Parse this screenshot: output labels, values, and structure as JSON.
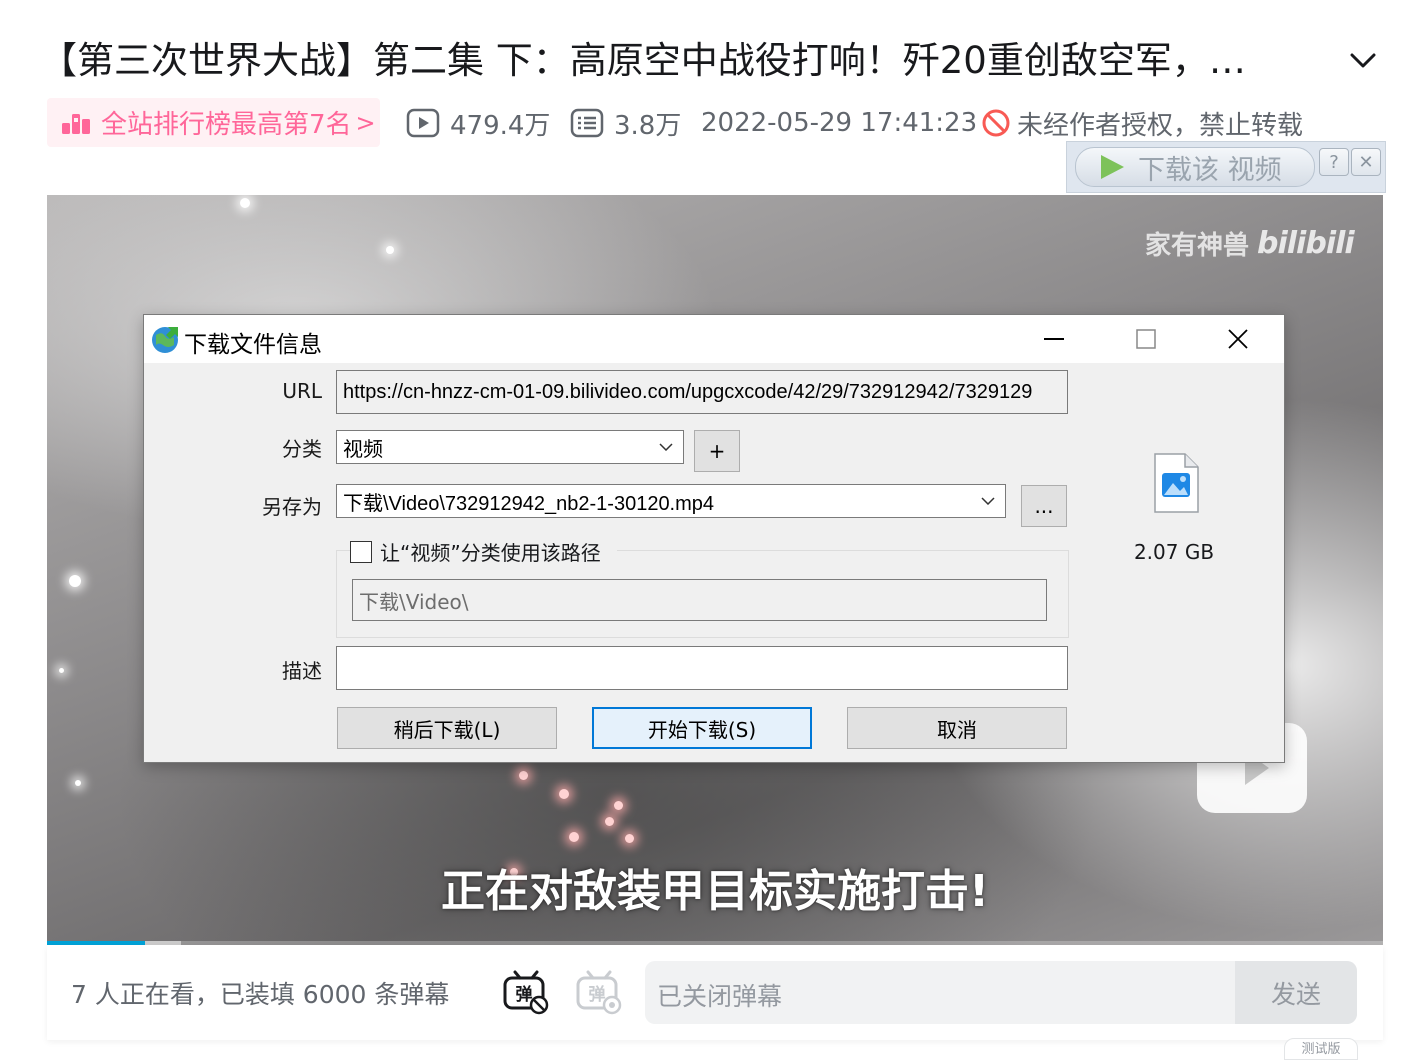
{
  "video": {
    "title": "【第三次世界大战】第二集 下：高原空中战役打响！歼20重创敌空军，…",
    "rank_badge": "全站排行榜最高第7名",
    "rank_arrow": ">",
    "views": "479.4万",
    "danmaku_count": "3.8万",
    "publish_time": "2022-05-29 17:41:23",
    "copyright_notice": "未经作者授权，禁止转载"
  },
  "idm_bar": {
    "download_label": "下载该 视频",
    "help_label": "?",
    "close_label": "✕"
  },
  "player": {
    "watermark_text": "家有神兽",
    "watermark_logo": "bilibili",
    "subtitle": "正在对敌装甲目标实施打击!",
    "progress_fraction": 0.073,
    "buffered_fraction": 0.1
  },
  "dialog": {
    "title": "下载文件信息",
    "url_label": "URL",
    "url_value": "https://cn-hnzz-cm-01-09.bilivideo.com/upgcxcode/42/29/732912942/7329129",
    "category_label": "分类",
    "category_value": "视频",
    "add_category_label": "+",
    "saveas_label": "另存为",
    "saveas_value": "下载\\Video\\732912942_nb2-1-30120.mp4",
    "browse_label": "...",
    "use_path_checkbox_label": "让“视频”分类使用该路径",
    "use_path_checked": false,
    "category_path_value": "下载\\Video\\",
    "description_label": "描述",
    "description_value": "",
    "file_size": "2.07  GB",
    "later_button": "稍后下载(L)",
    "start_button": "开始下载(S)",
    "cancel_button": "取消"
  },
  "bottom_bar": {
    "viewers_text": "7 人正在看，已装填 6000 条弹幕",
    "danmaku_placeholder": "已关闭弹幕",
    "send_label": "发送",
    "beta_tag": "测试版"
  },
  "colors": {
    "accent_pink": "#ff6699",
    "badge_bg": "#fff1f4",
    "meta_gray": "#61666d",
    "progress_blue": "#00a1d6",
    "forbid_red": "#f85a54",
    "dialog_bg": "#f0f0f0",
    "primary_border": "#0078d7"
  }
}
